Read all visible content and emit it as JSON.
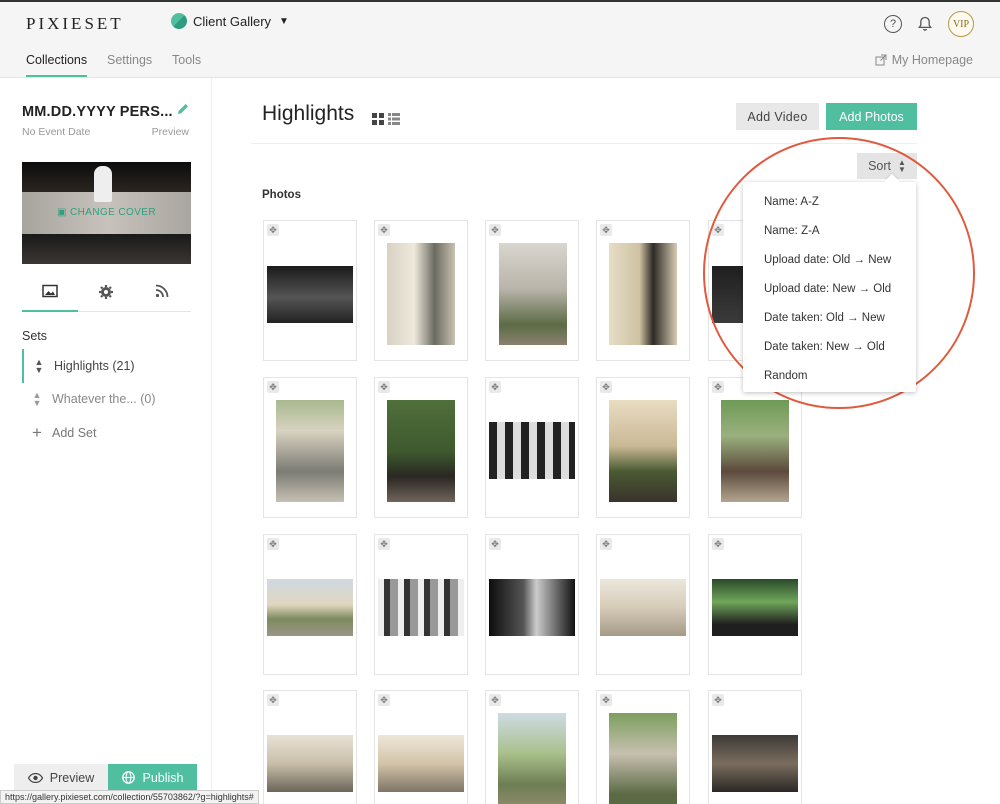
{
  "topbar": {
    "logo": "PIXIESET",
    "app_name": "Client Gallery",
    "help_icon": "question-circle-icon",
    "bell_icon": "bell-icon",
    "vip_badge": "VIP"
  },
  "subnav": {
    "tabs": [
      {
        "label": "Collections",
        "active": true
      },
      {
        "label": "Settings",
        "active": false
      },
      {
        "label": "Tools",
        "active": false
      }
    ],
    "homepage": "My Homepage"
  },
  "sidebar": {
    "collection_title": "MM.DD.YYYY PERS...",
    "event_date": "No Event Date",
    "preview": "Preview",
    "change_cover": "CHANGE COVER",
    "sets_label": "Sets",
    "sets": [
      {
        "label": "Highlights (21)",
        "active": true
      },
      {
        "label": "Whatever the... (0)",
        "active": false
      }
    ],
    "add_set": "Add Set",
    "preview_button": "Preview",
    "publish_button": "Publish"
  },
  "main": {
    "title": "Highlights",
    "add_video": "Add Video",
    "add_photos": "Add Photos",
    "sort_label": "Sort",
    "photos_label": "Photos"
  },
  "sort_menu": {
    "options": [
      "Name: A-Z",
      "Name: Z-A",
      "Upload date: Old → New",
      "Upload date: New → Old",
      "Date taken: Old → New",
      "Date taken: New → Old",
      "Random"
    ]
  },
  "status_bar": {
    "url": "https://gallery.pixieset.com/collection/55703862/?g=highlights#"
  },
  "colors": {
    "accent": "#4fbf9f",
    "annotation": "#e05a3d"
  }
}
